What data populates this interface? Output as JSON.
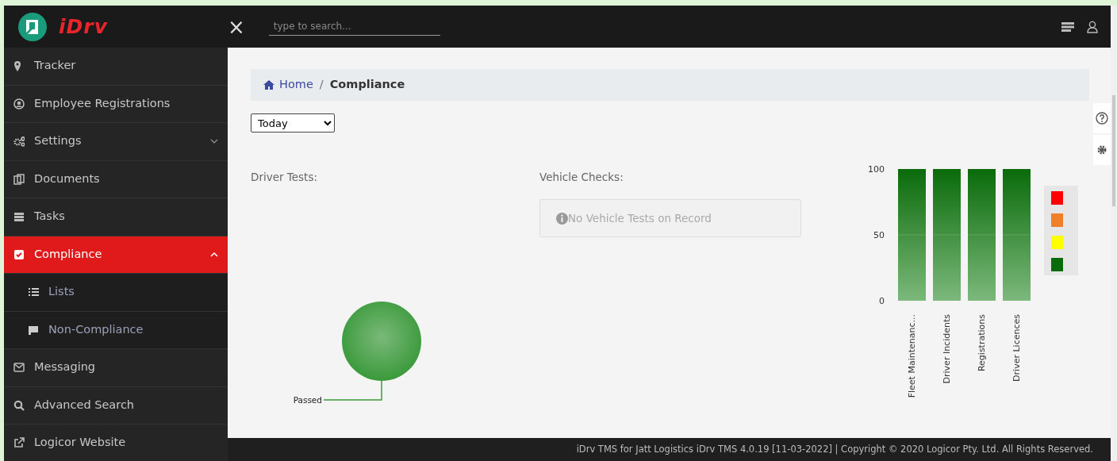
{
  "topbar": {
    "brand": "iDrv",
    "close": "×",
    "search": {
      "placeholder": "type to search..."
    }
  },
  "sidebar": {
    "items": [
      {
        "label": "Tracker",
        "selected": false
      },
      {
        "label": "Employee Registrations",
        "selected": false
      },
      {
        "label": "Settings",
        "selected": false,
        "expanded": false
      },
      {
        "label": "Documents",
        "selected": false
      },
      {
        "label": "Tasks",
        "selected": false
      },
      {
        "label": "Compliance",
        "selected": true,
        "expanded": true,
        "children": [
          {
            "label": "Lists",
            "selected": false
          },
          {
            "label": "Non-Compliance",
            "selected": false
          }
        ]
      },
      {
        "label": "Messaging",
        "selected": false
      },
      {
        "label": "Advanced Search",
        "selected": false
      },
      {
        "label": "Logicor Website",
        "selected": false
      }
    ]
  },
  "breadcrumb": {
    "separator": "/",
    "items": [
      {
        "label": "Home",
        "selected": false
      },
      {
        "label": "Compliance",
        "selected": true
      }
    ]
  },
  "period_select": {
    "value": "Today"
  },
  "driver_tests": {
    "title": "Driver Tests:",
    "pie_label": "Passed"
  },
  "vehicle_checks": {
    "title": "Vehicle Checks:",
    "message": "No Vehicle Tests on Record"
  },
  "compliance_chart": {
    "chart_data": {
      "type": "bar",
      "categories": [
        "Fleet Maintenanc...",
        "Driver Incidents",
        "Registrations",
        "Driver Licences"
      ],
      "series": [
        {
          "color": "#0a6b0a",
          "values": [
            100,
            100,
            100,
            100
          ]
        }
      ],
      "ylim": [
        0,
        100
      ],
      "yticks": [
        0,
        50,
        100
      ]
    },
    "legend": [
      {
        "color": "#ff0000"
      },
      {
        "color": "#f07f2a"
      },
      {
        "color": "#ffff00"
      },
      {
        "color": "#0a6b0a"
      }
    ]
  },
  "footer": "iDrv TMS for Jatt Logistics iDrv TMS 4.0.19 [11-03-2022] | Copyright © 2020 Logicor Pty. Ltd. All Rights Reserved."
}
